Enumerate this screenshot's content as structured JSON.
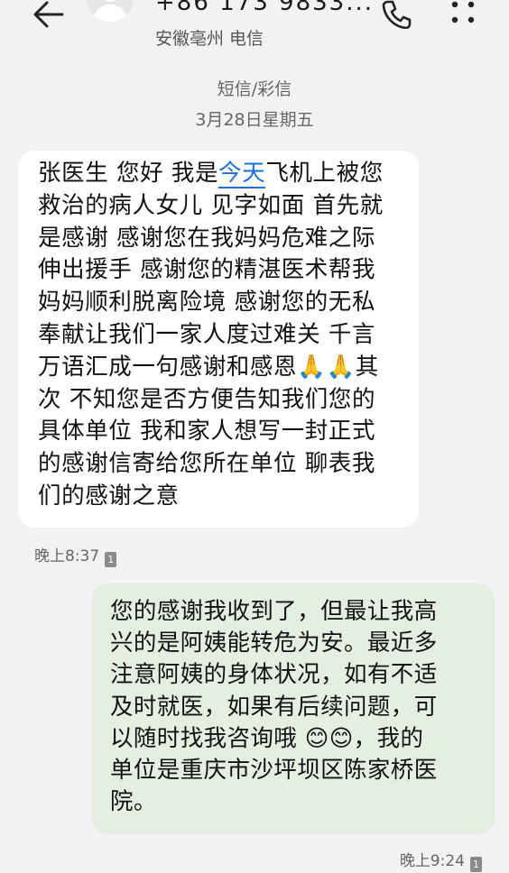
{
  "header": {
    "contact_number": "+86 173 9833...",
    "contact_location": "安徽亳州 电信"
  },
  "thread": {
    "type_label": "短信/彩信",
    "date_label": "3月28日星期五"
  },
  "messages": [
    {
      "direction": "incoming",
      "text_pre": "张医生 您好 我是",
      "link_text": "今天",
      "text_post": "飞机上被您\n救治的病人女儿 见字如面 首先就\n是感谢 感谢您在我妈妈危难之际\n伸出援手 感谢您的精湛医术帮我\n妈妈顺利脱离险境 感谢您的无私\n奉献让我们一家人度过难关 千言\n万语汇成一句感谢和感恩🙏🙏其\n次 不知您是否方便告知我们您的\n具体单位 我和家人想写一封正式\n的感谢信寄给您所在单位 聊表我\n们的感谢之意",
      "time": "晚上8:37",
      "sim": "1"
    },
    {
      "direction": "outgoing",
      "text": "您的感谢我收到了，但最让我高\n兴的是阿姨能转危为安。最近多\n注意阿姨的身体状况，如有不适\n及时就医，如果有后续问题，可\n以随时找我咨询哦 😊😊，我的\n单位是重庆市沙坪坝区陈家桥医\n院。",
      "time": "晚上9:24",
      "sim": "1"
    }
  ],
  "icons": {
    "back": "back-arrow-icon",
    "avatar": "default-avatar",
    "call": "phone-icon",
    "more": "more-vertical-icon"
  },
  "colors": {
    "background": "#f2f2f2",
    "incoming_bubble": "#ffffff",
    "outgoing_bubble": "#e4efe2",
    "link": "#1a6fd8"
  }
}
